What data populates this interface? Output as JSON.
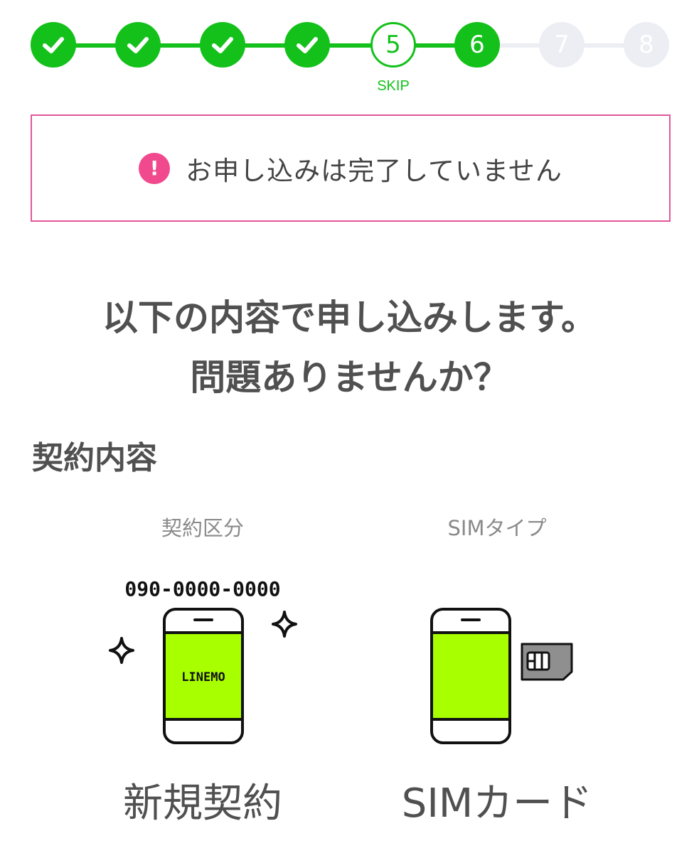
{
  "stepper": {
    "steps": [
      {
        "label": "",
        "state": "done"
      },
      {
        "label": "",
        "state": "done"
      },
      {
        "label": "",
        "state": "done"
      },
      {
        "label": "",
        "state": "done"
      },
      {
        "label": "5",
        "state": "skipped",
        "note": "SKIP"
      },
      {
        "label": "6",
        "state": "current"
      },
      {
        "label": "7",
        "state": "todo"
      },
      {
        "label": "8",
        "state": "todo"
      }
    ],
    "skip_label": "SKIP"
  },
  "alert": {
    "icon": "exclamation-icon",
    "message": "お申し込みは完了していません"
  },
  "confirm": {
    "line1": "以下の内容で申し込みします。",
    "line2": "問題ありませんか？"
  },
  "contract": {
    "section_title": "契約内容",
    "contract_type": {
      "label": "契約区分",
      "phone_number": "090-0000-0000",
      "screen_text": "LINEMO",
      "value": "新規契約"
    },
    "sim_type": {
      "label": "SIMタイプ",
      "value": "SIMカード"
    }
  },
  "colors": {
    "step_green": "#13c11a",
    "step_todo": "#eceef3",
    "alert_border": "#e0579a",
    "alert_icon": "#f0498d",
    "phone_screen": "#a8ff00"
  }
}
